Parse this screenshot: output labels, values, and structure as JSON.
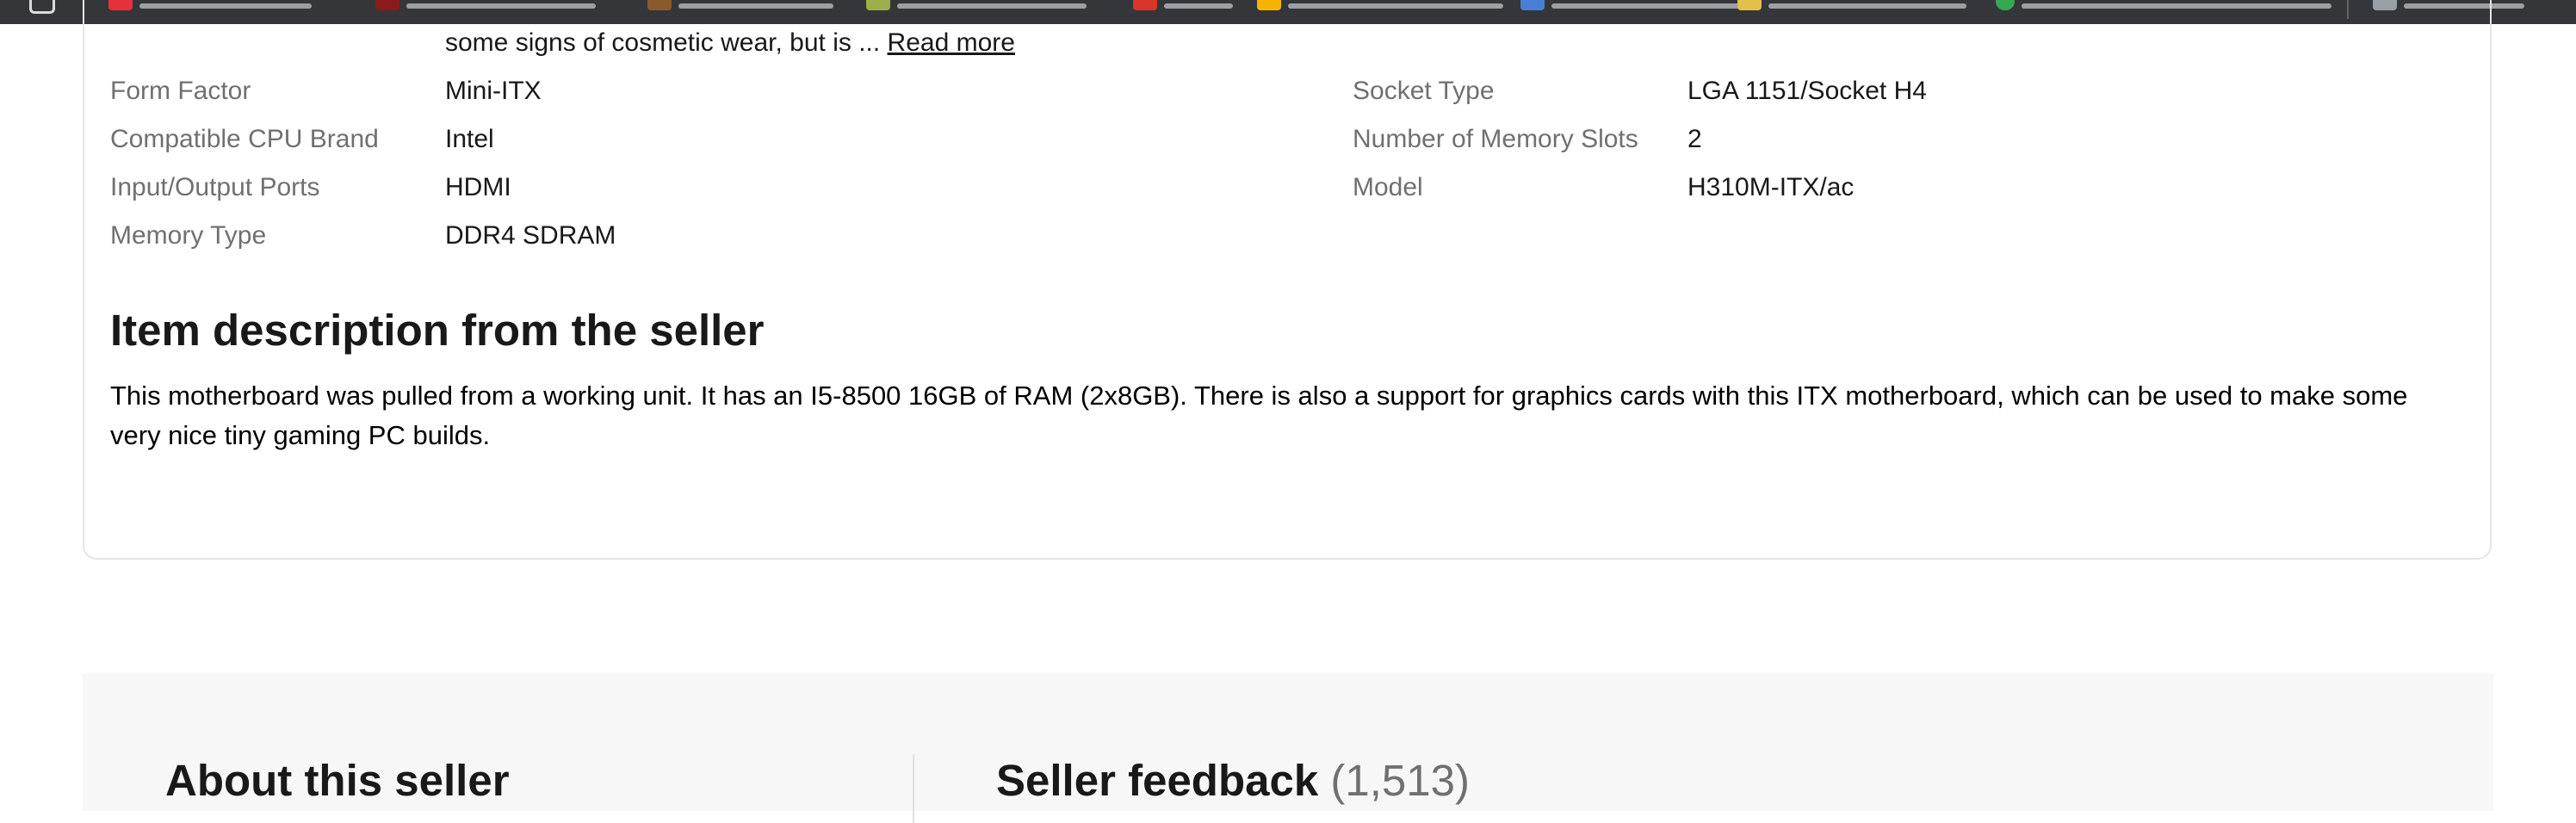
{
  "condition": {
    "text": "some signs of cosmetic wear, but is ...",
    "read_more": "Read more"
  },
  "specs": {
    "left": [
      {
        "label": "Form Factor",
        "value": "Mini-ITX"
      },
      {
        "label": "Compatible CPU Brand",
        "value": "Intel"
      },
      {
        "label": "Input/Output Ports",
        "value": "HDMI"
      },
      {
        "label": "Memory Type",
        "value": "DDR4 SDRAM"
      }
    ],
    "right": [
      {
        "label": "Socket Type",
        "value": "LGA 1151/Socket H4"
      },
      {
        "label": "Number of Memory Slots",
        "value": "2"
      },
      {
        "label": "Model",
        "value": "H310M-ITX/ac"
      }
    ]
  },
  "description": {
    "heading": "Item description from the seller",
    "text": "This motherboard was pulled from a working unit. It has an I5-8500 16GB of RAM (2x8GB). There is also a support for graphics cards with this ITX motherboard, which can be used to make some very nice tiny gaming PC builds."
  },
  "seller": {
    "about_heading": "About this seller",
    "feedback_heading": "Seller feedback",
    "feedback_count": "(1,513)"
  },
  "bookmarks_bar": {
    "background": "#35363a",
    "icons": [
      "apps-icon",
      "bookmark-icon",
      "bookmark-icon",
      "bookmark-icon",
      "bookmark-icon",
      "bookmark-icon",
      "bookmark-icon",
      "bookmark-icon",
      "bookmark-icon",
      "bookmark-icon",
      "bookmark-icon",
      "folder-icon"
    ]
  },
  "colors": {
    "label_gray": "#707070",
    "text_dark": "#191919",
    "panel_bg": "#f7f7f7",
    "border": "#e5e5e5"
  }
}
